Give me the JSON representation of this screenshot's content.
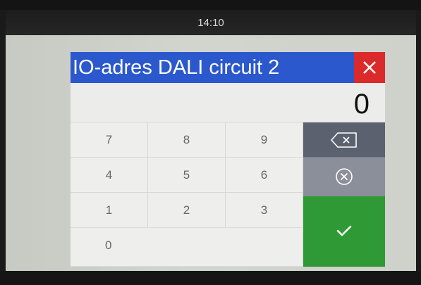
{
  "statusbar": {
    "time": "14:10"
  },
  "dialog": {
    "title": "IO-adres DALI circuit 2",
    "display_value": "0",
    "keys": [
      "7",
      "8",
      "9",
      "4",
      "5",
      "6",
      "1",
      "2",
      "3",
      "0"
    ],
    "icons": {
      "close": "close-icon",
      "backspace": "backspace-icon",
      "clear": "clear-circle-icon",
      "confirm": "checkmark-icon"
    },
    "colors": {
      "title_bar": "#2b58cc",
      "close_button": "#db2a2a",
      "backspace_button": "#5b616f",
      "clear_button": "#8a8f9a",
      "confirm_button": "#2f9a35"
    }
  }
}
